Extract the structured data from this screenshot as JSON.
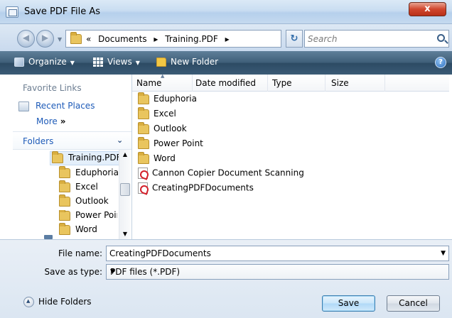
{
  "window": {
    "title": "Save PDF File As",
    "close_label": "x"
  },
  "address": {
    "crumbs": [
      "«",
      "Documents",
      "▸",
      "Training.PDF",
      "▸"
    ],
    "search_placeholder": "Search"
  },
  "toolbar": {
    "organize_label": "Organize",
    "views_label": "Views",
    "new_folder_label": "New Folder",
    "help_label": "?"
  },
  "nav": {
    "favorite_links_label": "Favorite Links",
    "recent_places_label": "Recent Places",
    "more_label": "More",
    "more_chevron": "»",
    "folders_label": "Folders",
    "tree": [
      "Training.PDF",
      "Eduphoria",
      "Excel",
      "Outlook",
      "Power Poir",
      "Word"
    ]
  },
  "filelist": {
    "columns": [
      "Name",
      "Date modified",
      "Type",
      "Size"
    ],
    "items": [
      {
        "name": "Eduphoria",
        "kind": "folder"
      },
      {
        "name": "Excel",
        "kind": "folder"
      },
      {
        "name": "Outlook",
        "kind": "folder"
      },
      {
        "name": "Power Point",
        "kind": "folder"
      },
      {
        "name": "Word",
        "kind": "folder"
      },
      {
        "name": "Cannon Copier Document Scanning",
        "kind": "pdf"
      },
      {
        "name": "CreatingPDFDocuments",
        "kind": "pdf"
      }
    ]
  },
  "bottom": {
    "file_name_label": "File name:",
    "file_name_value": "CreatingPDFDocuments",
    "save_type_label": "Save as type:",
    "save_type_value": "PDF files (*.PDF)",
    "hide_folders_label": "Hide Folders",
    "save_label": "Save",
    "cancel_label": "Cancel"
  },
  "colors": {
    "link_blue": "#1e5bb8",
    "toolbar_dark": "#3e5e78",
    "close_red": "#d0462d"
  }
}
